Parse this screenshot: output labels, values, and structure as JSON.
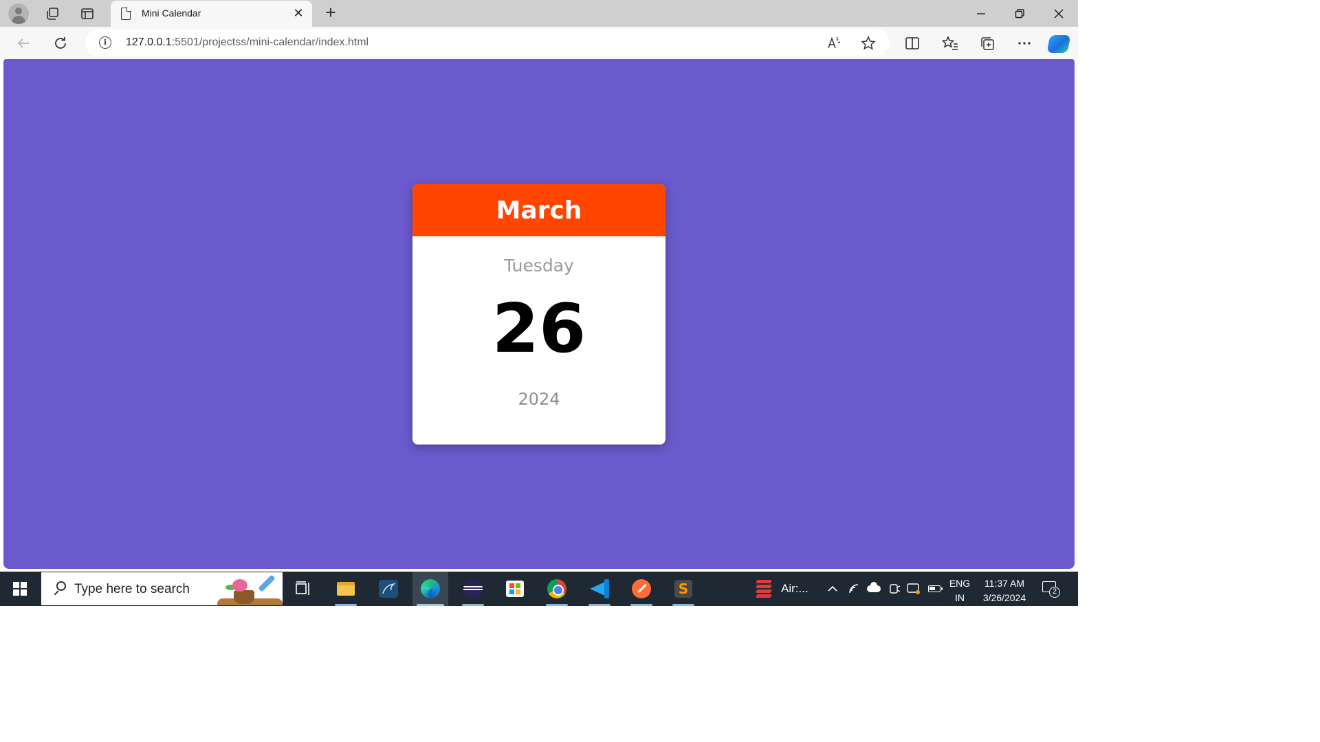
{
  "browser": {
    "tab": {
      "title": "Mini Calendar"
    },
    "address": {
      "host": "127.0.0.1",
      "rest": ":5501/projectss/mini-calendar/index.html"
    }
  },
  "calendar": {
    "month": "March",
    "weekday": "Tuesday",
    "date": "26",
    "year": "2024",
    "colors": {
      "background": "#6a5acd",
      "header": "#ff4500"
    }
  },
  "taskbar": {
    "search_placeholder": "Type here to search",
    "pinned": [
      "task-view",
      "file-explorer",
      "mysql-workbench",
      "edge",
      "eclipse",
      "microsoft-store",
      "chrome",
      "vscode",
      "postman",
      "sublime-text"
    ],
    "active_app": "edge",
    "air_label": "Air:...",
    "language": [
      "ENG",
      "IN"
    ],
    "time": "11:37 AM",
    "date": "3/26/2024",
    "notification_count": "2"
  }
}
